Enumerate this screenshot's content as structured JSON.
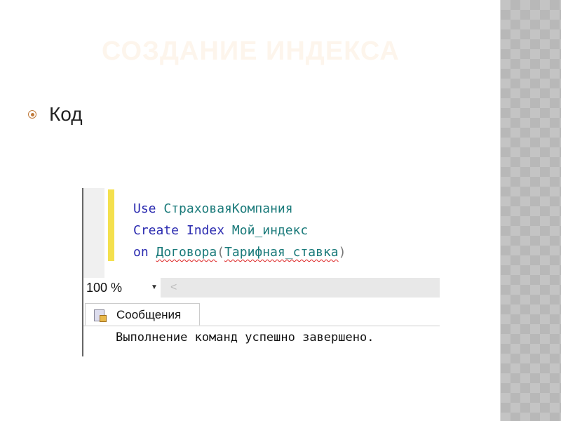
{
  "slide": {
    "title": "СОЗДАНИЕ ИНДЕКСА",
    "bullet": "Код"
  },
  "editor": {
    "line1": {
      "kw": "Use",
      "rest": "СтраховаяКомпания"
    },
    "line2": {
      "kw": "Create Index",
      "rest": "Мой_индекс"
    },
    "line3": {
      "kw": "on",
      "table": "Договора",
      "open": "(",
      "col": "Тарифная_ставка",
      "close": ")"
    }
  },
  "zoom": {
    "value": "100 %",
    "arrow": "▼",
    "scroll_left": "<"
  },
  "results": {
    "tab_label": "Сообщения",
    "message": "Выполнение команд успешно завершено."
  }
}
